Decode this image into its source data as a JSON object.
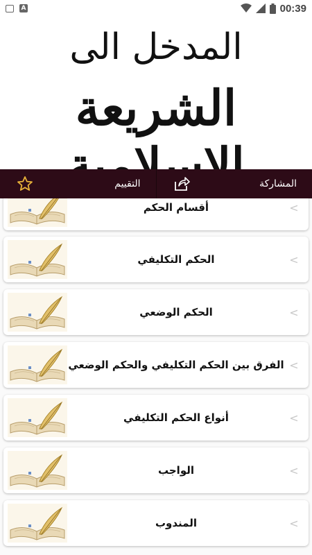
{
  "status_bar": {
    "time": "00:39",
    "left_icons": [
      "image-icon",
      "a-icon"
    ],
    "right_icons": [
      "wifi-icon",
      "signal-icon",
      "battery-icon"
    ]
  },
  "banner": {
    "line1": "المدخل الى",
    "line2": "الشريعة الإسلامية"
  },
  "action_bar": {
    "share_label": "المشاركة",
    "rate_label": "التقييم",
    "background": "#2d0b17"
  },
  "list": {
    "items": [
      {
        "title": "أقسام الحكم"
      },
      {
        "title": "الحكم التكليفي"
      },
      {
        "title": "الحكم الوضعي"
      },
      {
        "title": "الفرق بين الحكم التكليفي والحكم الوضعي"
      },
      {
        "title": "أنواع الحكم التكليفي"
      },
      {
        "title": "الواجب"
      },
      {
        "title": "المندوب"
      }
    ],
    "chevron": "<"
  }
}
